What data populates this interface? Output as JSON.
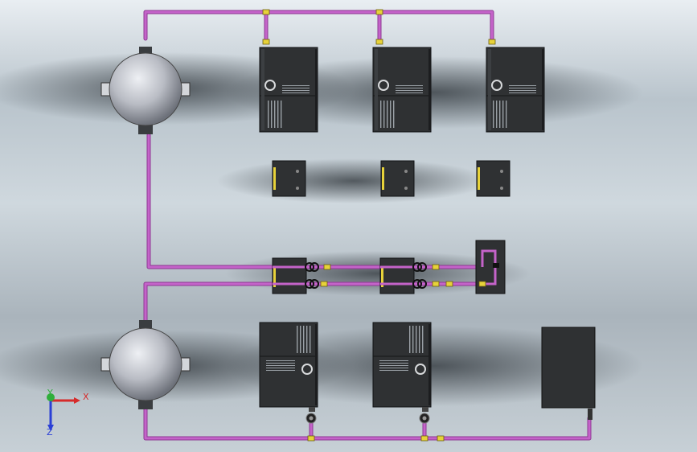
{
  "window": {
    "title": ""
  },
  "colors": {
    "pipe": "#c463c9",
    "pipe_dark": "#8e3a93",
    "unit_body": "#2f3133",
    "unit_edge": "#111214",
    "valve": "#e7d23a",
    "tank": "#b9bcc4",
    "axis_x": "#d62a2a",
    "axis_y": "#2fae3b",
    "axis_z": "#2a3fd6"
  },
  "triad": {
    "x_label": "X",
    "y_label": "Y",
    "z_label": "Z"
  },
  "components": {
    "tanks": [
      {
        "name": "upper-tank"
      },
      {
        "name": "lower-tank"
      }
    ],
    "upper_units": 3,
    "small_boxes": 3,
    "middle_boxes": 2,
    "lower_units": 2,
    "right_cabinet": 1
  }
}
